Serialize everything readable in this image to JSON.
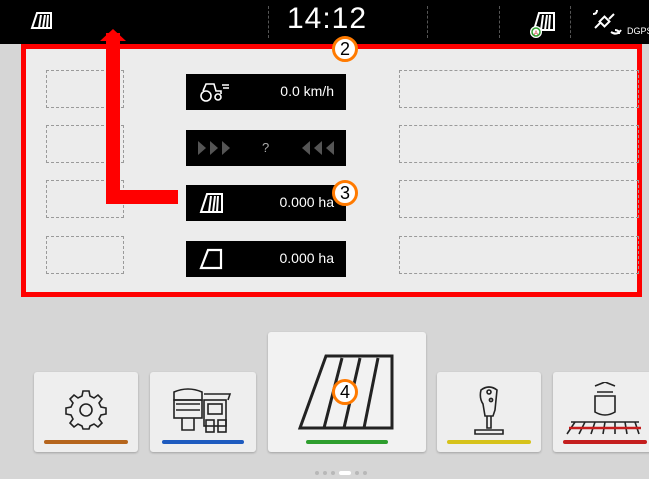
{
  "statusbar": {
    "time": "14:12",
    "gps_label": "DGPS",
    "icons": [
      "field-work-icon",
      "field-work-auto-icon",
      "gps-satellite-icon"
    ]
  },
  "panel": {
    "speed": {
      "icon": "tractor-speed-icon",
      "value": "0.0 km/h"
    },
    "lateral": {
      "icon": "lateral-guidance-icon",
      "value": "?"
    },
    "area_partial": {
      "icon": "partial-area-icon",
      "value": "0.000 ha"
    },
    "area_total": {
      "icon": "total-area-icon",
      "value": "0.000 ha"
    }
  },
  "annotations": {
    "badge_2": "2",
    "badge_3": "3",
    "badge_4": "4"
  },
  "menu": {
    "tiles": [
      {
        "name": "settings",
        "icon": "gear-icon",
        "bar_color": "#b5651d"
      },
      {
        "name": "machine",
        "icon": "machine-icon",
        "bar_color": "#1e5bbf"
      },
      {
        "name": "field",
        "icon": "field-icon",
        "bar_color": "#2e9e2e"
      },
      {
        "name": "joystick",
        "icon": "joystick-icon",
        "bar_color": "#d6c21a"
      },
      {
        "name": "seeder",
        "icon": "seeder-icon",
        "bar_color": "#c41e1e"
      }
    ],
    "page_indicator": {
      "current": 4,
      "total": 6
    }
  },
  "colors": {
    "highlight": "#ff0000",
    "badge_ring": "#ff7a00"
  }
}
